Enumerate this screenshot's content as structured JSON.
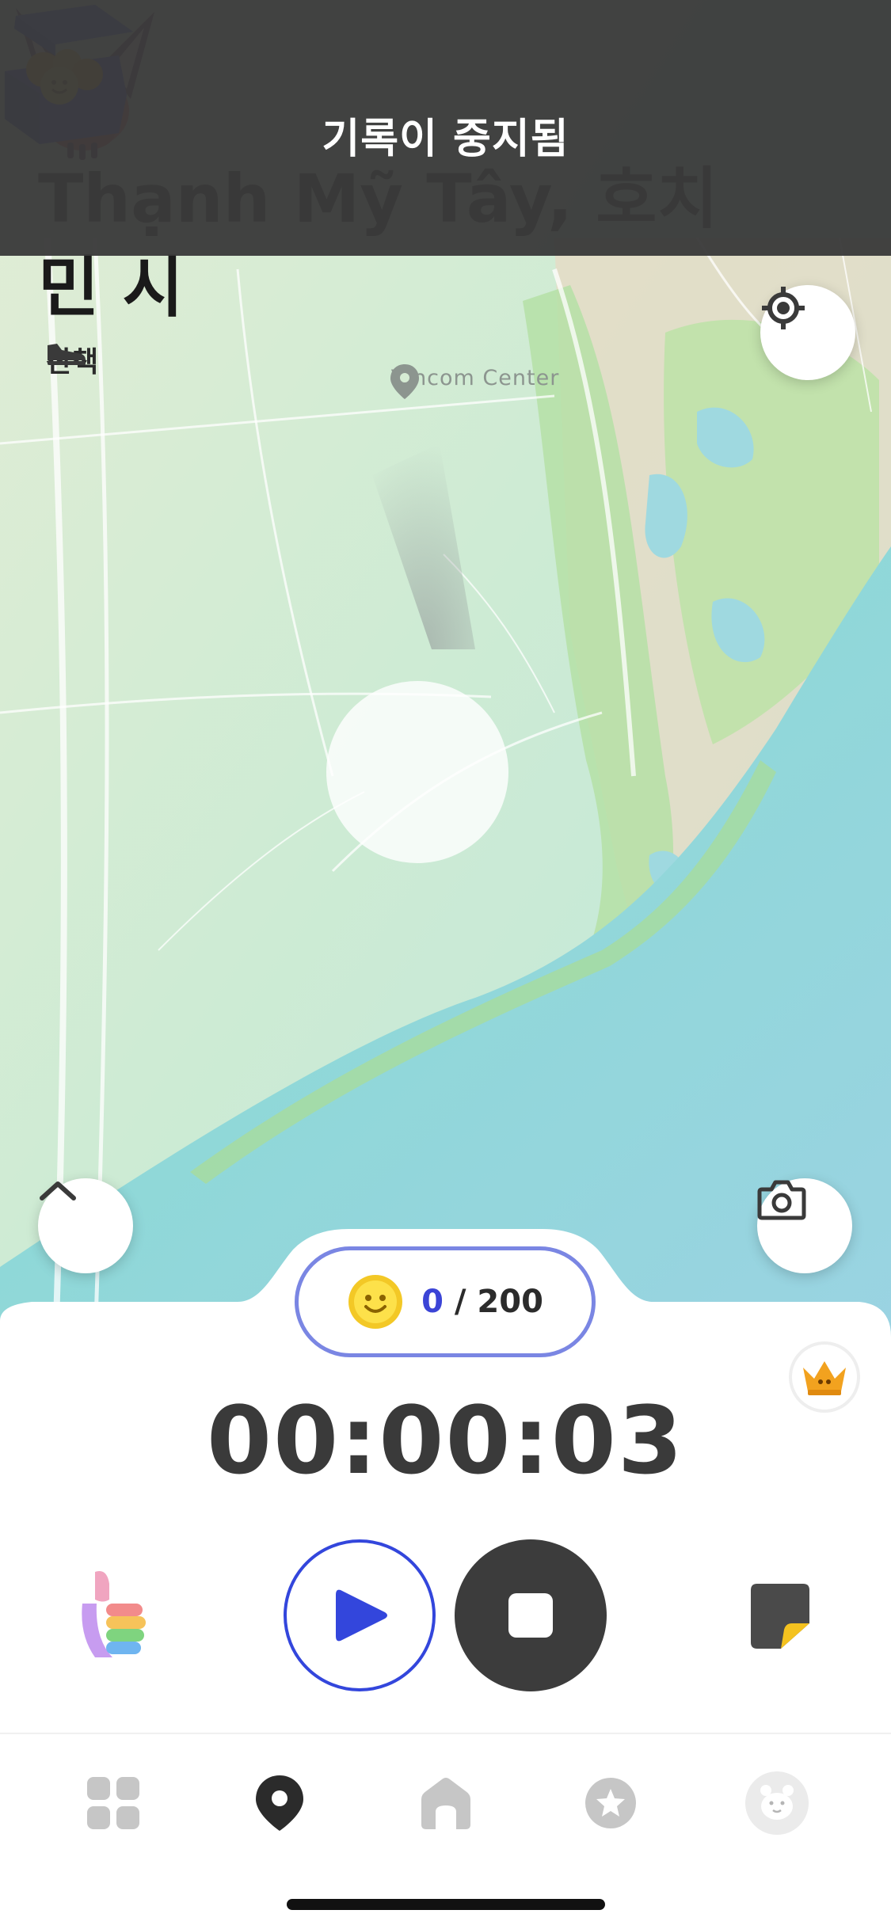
{
  "toast": {
    "text": "기록이 중지됨"
  },
  "location": {
    "title": "Thạnh Mỹ Tây, 호치민 시",
    "activity_label": "산책",
    "activity_icon": "shoe-icon"
  },
  "map": {
    "poi_label": "Vincom Center",
    "poi_icon": "map-pin-icon"
  },
  "coins": {
    "current": "0",
    "separator": " / ",
    "goal": "200"
  },
  "timer": {
    "elapsed": "00:00:03"
  },
  "controls": {
    "play_icon": "play-icon",
    "stop_icon": "stop-icon",
    "left_icon": "rainbow-thumbs-up-icon",
    "right_icon": "sticker-icon"
  },
  "tabbar": {
    "items": [
      {
        "icon": "grid-icon",
        "active": false
      },
      {
        "icon": "map-pin-icon",
        "active": true
      },
      {
        "icon": "home-icon",
        "active": false
      },
      {
        "icon": "star-badge-icon",
        "active": false
      },
      {
        "icon": "bear-face-icon",
        "active": false
      }
    ]
  },
  "colors": {
    "accent_blue": "#3346dc",
    "pill_border": "#7a86e3",
    "stop_button": "#3c3c3c",
    "toast_bg": "#3a3a3a",
    "map_land": "#d6ecd4",
    "map_water": "#8fd6da"
  }
}
